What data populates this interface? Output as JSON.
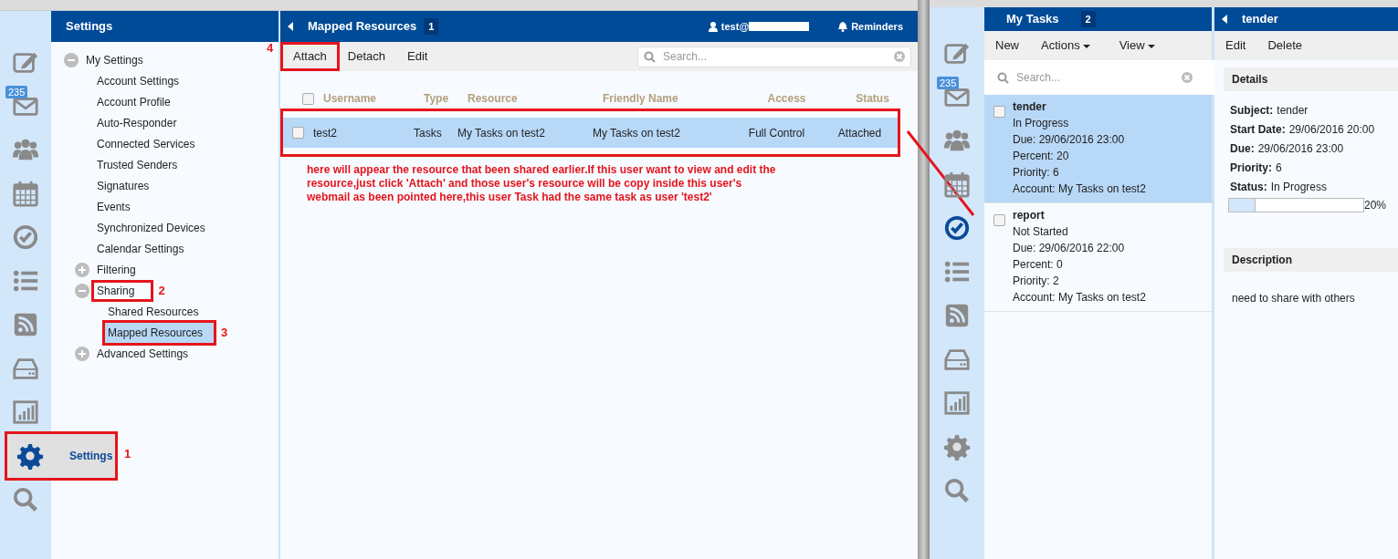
{
  "left_window": {
    "rail": {
      "items": [
        {
          "kind": "compose",
          "selected": false
        },
        {
          "kind": "mail",
          "badge": "235",
          "selected": false
        },
        {
          "kind": "contacts",
          "selected": false
        },
        {
          "kind": "calendar",
          "selected": false
        },
        {
          "kind": "tasks",
          "selected": false
        },
        {
          "kind": "list",
          "selected": false
        },
        {
          "kind": "rss",
          "selected": false
        },
        {
          "kind": "drive",
          "selected": false
        },
        {
          "kind": "chart",
          "selected": false
        },
        {
          "kind": "settings",
          "selected": true,
          "label": "Settings",
          "callout": "1"
        },
        {
          "kind": "search",
          "selected": false
        }
      ]
    },
    "settings_panel": {
      "title": "Settings",
      "tree": [
        {
          "label": "My Settings",
          "expanded": true,
          "children": [
            {
              "label": "Account Settings",
              "selected": false
            },
            {
              "label": "Account Profile",
              "selected": false
            },
            {
              "label": "Auto-Responder",
              "selected": false
            },
            {
              "label": "Connected Services",
              "selected": false
            },
            {
              "label": "Trusted Senders",
              "selected": false
            },
            {
              "label": "Signatures",
              "selected": false
            },
            {
              "label": "Events",
              "selected": false
            },
            {
              "label": "Synchronized Devices",
              "selected": false
            },
            {
              "label": "Calendar Settings",
              "selected": false
            },
            {
              "label": "Filtering",
              "expanded": false
            },
            {
              "label": "Sharing",
              "expanded": true,
              "callout": "2",
              "children": [
                {
                  "label": "Shared Resources",
                  "selected": false
                },
                {
                  "label": "Mapped Resources",
                  "selected": true,
                  "callout": "3"
                }
              ]
            },
            {
              "label": "Advanced Settings",
              "expanded": false
            }
          ]
        }
      ]
    },
    "header": {
      "title": "Mapped Resources",
      "count": "1",
      "user": "test@",
      "reminders": "Reminders"
    },
    "toolbar": [
      {
        "label": "Attach",
        "callout": "4"
      },
      {
        "label": "Detach"
      },
      {
        "label": "Edit"
      }
    ],
    "search": {
      "placeholder": "Search..."
    },
    "table": {
      "header_checked": false,
      "columns": [
        "Username",
        "Type",
        "Resource",
        "Friendly Name",
        "Access",
        "Status"
      ],
      "rows": [
        {
          "cells": [
            "test2",
            "Tasks",
            "My Tasks on test2",
            "My Tasks on test2",
            "Full Control",
            "Attached"
          ],
          "selected": true,
          "checked": false,
          "highlighted": true
        }
      ]
    },
    "note": "here will appear the resource that been shared earlier.If this user want to view and edit the resource,just click 'Attach' and those user's resource will be copy inside this user's webmail as been pointed here,this user Task had the same task as user 'test2'"
  },
  "right_window": {
    "rail": {
      "items": [
        {
          "kind": "compose",
          "selected": false
        },
        {
          "kind": "mail",
          "badge": "235",
          "selected": false
        },
        {
          "kind": "contacts",
          "selected": false
        },
        {
          "kind": "calendar",
          "selected": false
        },
        {
          "kind": "tasks",
          "selected": true
        },
        {
          "kind": "list",
          "selected": false
        },
        {
          "kind": "rss",
          "selected": false
        },
        {
          "kind": "drive",
          "selected": false
        },
        {
          "kind": "chart",
          "selected": false
        },
        {
          "kind": "settings",
          "selected": false
        },
        {
          "kind": "search",
          "selected": false
        }
      ]
    },
    "task_list": {
      "title": "My Tasks",
      "count": "2",
      "toolbar": [
        {
          "label": "New",
          "kind": "button"
        },
        {
          "label": "Actions",
          "kind": "dropdown"
        },
        {
          "label": "View",
          "kind": "dropdown"
        }
      ],
      "search": {
        "placeholder": "Search..."
      },
      "tasks": [
        {
          "title": "tender",
          "selected": true,
          "checked": false,
          "lines": [
            "In Progress",
            "Due: 29/06/2016 23:00",
            "Percent: 20",
            "Priority: 6",
            "Account: My Tasks on test2"
          ]
        },
        {
          "title": "report",
          "selected": false,
          "checked": false,
          "lines": [
            "Not Started",
            "Due: 29/06/2016 22:00",
            "Percent: 0",
            "Priority: 2",
            "Account: My Tasks on test2"
          ]
        }
      ]
    },
    "detail": {
      "title": "tender",
      "toolbar": [
        "Edit",
        "Delete"
      ],
      "details_heading": "Details",
      "fields": [
        {
          "label": "Subject:",
          "value": "tender"
        },
        {
          "label": "Start Date:",
          "value": "29/06/2016 20:00"
        },
        {
          "label": "Due:",
          "value": "29/06/2016 23:00"
        },
        {
          "label": "Priority:",
          "value": "6"
        },
        {
          "label": "Status:",
          "value": "In Progress"
        }
      ],
      "progress": {
        "level": 0.2,
        "reading": "20%"
      },
      "description_heading": "Description",
      "description": "need to share with others"
    }
  }
}
